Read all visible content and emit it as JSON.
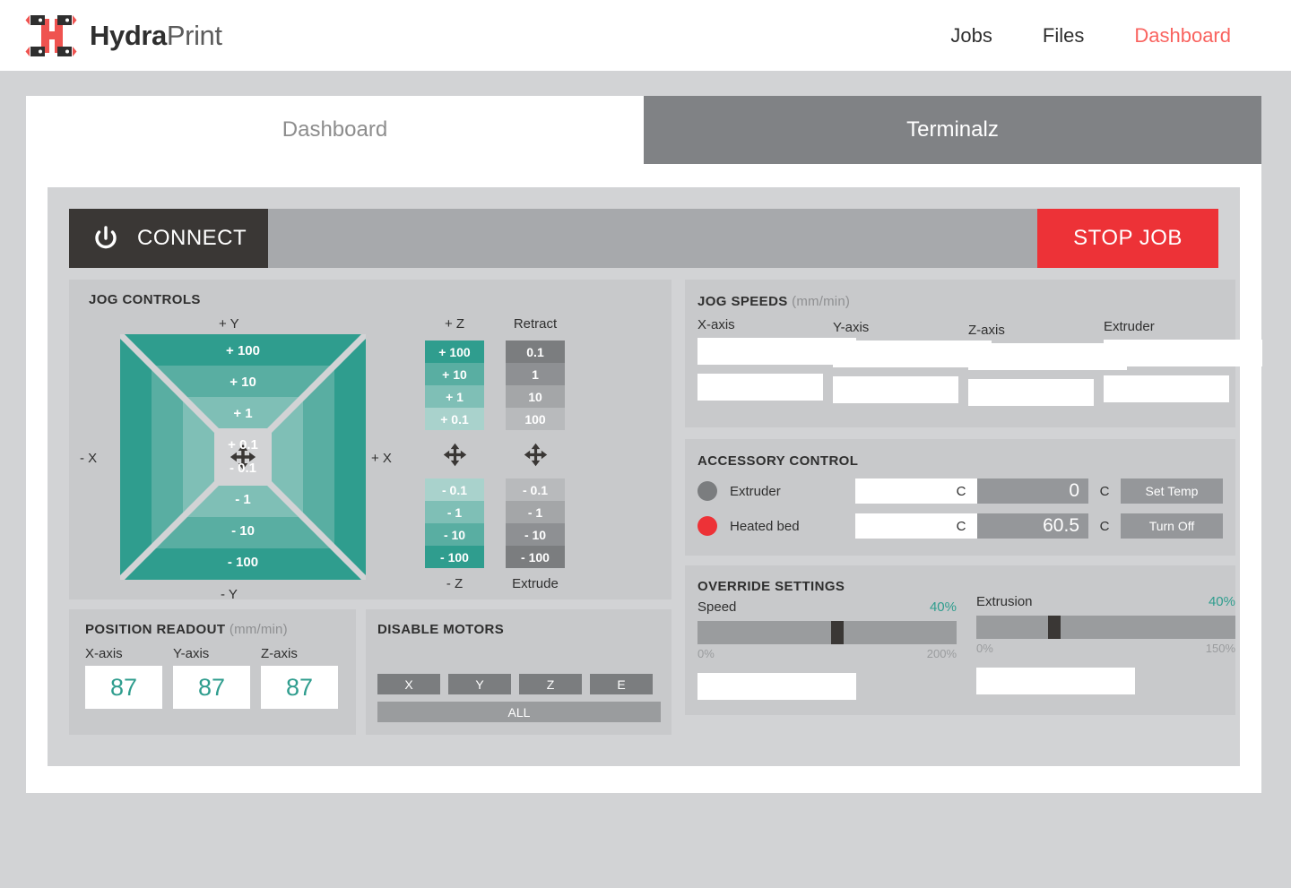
{
  "brand": {
    "name_bold": "Hydra",
    "name_light": "Print"
  },
  "nav": {
    "links": [
      {
        "label": "Jobs",
        "active": false
      },
      {
        "label": "Files",
        "active": false
      },
      {
        "label": "Dashboard",
        "active": true
      }
    ]
  },
  "tabs": [
    {
      "label": "Dashboard",
      "active": true
    },
    {
      "label": "Terminalz",
      "active": false
    }
  ],
  "connect_bar": {
    "connect_label": "CONNECT",
    "stop_label": "STOP JOB"
  },
  "jog_controls": {
    "title": "JOG CONTROLS",
    "axis_labels": {
      "plus_y": "+ Y",
      "minus_y": "- Y",
      "plus_x": "+ X",
      "minus_x": "- X"
    },
    "pad_positive": [
      "+ 100",
      "+ 10",
      "+ 1",
      "+ 0.1"
    ],
    "pad_negative": [
      "- 0.1",
      "- 1",
      "- 10",
      "- 100"
    ],
    "z_column": {
      "header": "+ Z",
      "footer": "- Z",
      "positive": [
        "+ 100",
        "+ 10",
        "+ 1",
        "+ 0.1"
      ],
      "negative": [
        "- 0.1",
        "- 1",
        "- 10",
        "- 100"
      ]
    },
    "retract_column": {
      "header": "Retract",
      "footer": "Extrude",
      "positive": [
        "0.1",
        "1",
        "10",
        "100"
      ],
      "negative": [
        "- 0.1",
        "- 1",
        "- 10",
        "- 100"
      ]
    }
  },
  "position_readout": {
    "title": "POSITION READOUT",
    "unit": "(mm/min)",
    "axes": [
      {
        "label": "X-axis",
        "value": "87"
      },
      {
        "label": "Y-axis",
        "value": "87"
      },
      {
        "label": "Z-axis",
        "value": "87"
      }
    ]
  },
  "disable_motors": {
    "title": "DISABLE MOTORS",
    "buttons": [
      "X",
      "Y",
      "Z",
      "E"
    ],
    "all_label": "ALL"
  },
  "jog_speeds": {
    "title": "JOG SPEEDS",
    "unit": "(mm/min)",
    "fields": [
      {
        "label": "X-axis",
        "value": "",
        "placeholder": ""
      },
      {
        "label": "Y-axis",
        "value": "",
        "placeholder": ""
      },
      {
        "label": "Z-axis",
        "value": "",
        "placeholder": ""
      },
      {
        "label": "Extruder",
        "value": "",
        "placeholder": ""
      }
    ]
  },
  "accessory_control": {
    "title": "ACCESSORY CONTROL",
    "unit": "C",
    "rows": [
      {
        "name": "Extruder",
        "dot_color": "#7b7d7f",
        "input_value": "",
        "readout": "0",
        "button": "Set Temp"
      },
      {
        "name": "Heated bed",
        "dot_color": "#ed3237",
        "input_value": "",
        "readout": "60.5",
        "button": "Turn Off"
      }
    ]
  },
  "override_settings": {
    "title": "OVERRIDE SETTINGS",
    "sliders": [
      {
        "name": "Speed",
        "percent": "40%",
        "min": "0%",
        "max": "200%",
        "handle_pct": 54,
        "input_value": ""
      },
      {
        "name": "Extrusion",
        "percent": "40%",
        "min": "0%",
        "max": "150%",
        "handle_pct": 30,
        "input_value": ""
      }
    ]
  },
  "colors": {
    "accent_teal": "#2f9d8e",
    "brand_red": "#f9635f",
    "stop_red": "#ed3237",
    "dark": "#3a3735",
    "page_bg": "#d2d3d5",
    "panel_bg": "#c8c9cb"
  }
}
